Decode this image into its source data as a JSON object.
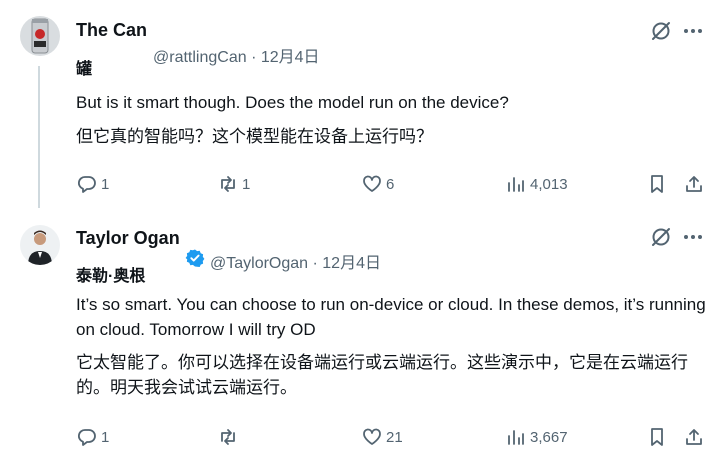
{
  "colors": {
    "text": "#0f1419",
    "secondary": "#536471",
    "verified": "#1d9bf0",
    "line": "#cfd9de"
  },
  "tweets": [
    {
      "display_name": "The Can",
      "sub_name": "罐",
      "handle_date": "@rattlingCan · 12月4日",
      "body_en": "But is it smart though. Does the model run on the device?",
      "body_zh": "但它真的智能吗？这个模型能在设备上运行吗？",
      "replies": "1",
      "reposts": "1",
      "likes": "6",
      "views": "4,013"
    },
    {
      "display_name": "Taylor Ogan",
      "sub_name": "泰勒·奥根",
      "handle_date": "@TaylorOgan · 12月4日",
      "verified": true,
      "body_en": "It’s so smart. You can choose to run on-device or cloud. In these demos, it’s running on cloud. Tomorrow I will try OD",
      "body_zh": "它太智能了。你可以选择在设备端运行或云端运行。这些演示中，它是在云端运行的。明天我会试试云端运行。",
      "replies": "1",
      "reposts": "",
      "likes": "21",
      "views": "3,667"
    }
  ],
  "icons": [
    "reply-icon",
    "repost-icon",
    "like-icon",
    "views-icon",
    "bookmark-icon",
    "share-icon",
    "grok-icon",
    "more-icon",
    "verified-icon"
  ]
}
